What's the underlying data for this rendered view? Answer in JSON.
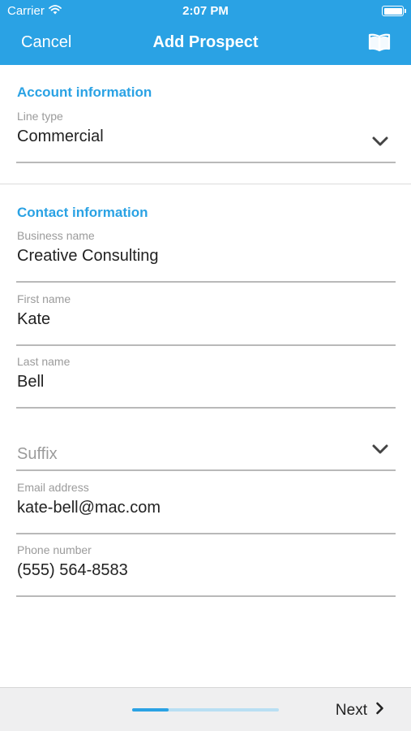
{
  "status_bar": {
    "carrier": "Carrier",
    "time": "2:07 PM",
    "icons": [
      "wifi-icon",
      "battery-icon"
    ]
  },
  "nav": {
    "cancel_label": "Cancel",
    "title": "Add Prospect",
    "right_icon": "book-icon"
  },
  "account_section": {
    "title": "Account information",
    "line_type": {
      "label": "Line type",
      "value": "Commercial",
      "icon": "chevron-down-icon"
    }
  },
  "contact_section": {
    "title": "Contact information",
    "business_name": {
      "label": "Business name",
      "value": "Creative Consulting"
    },
    "first_name": {
      "label": "First name",
      "value": "Kate"
    },
    "last_name": {
      "label": "Last name",
      "value": "Bell"
    },
    "suffix": {
      "placeholder": "Suffix",
      "icon": "chevron-down-icon"
    },
    "email": {
      "label": "Email address",
      "value": "kate-bell@mac.com"
    },
    "phone": {
      "label": "Phone number",
      "value": "(555) 564-8583"
    }
  },
  "footer": {
    "progress_fraction": 0.25,
    "next_label": "Next",
    "next_icon": "chevron-right-icon"
  },
  "colors": {
    "accent": "#2aa2e4",
    "label_gray": "#9b9b9b",
    "underline": "#b9b9b9",
    "footer_bg": "#efeff0"
  }
}
